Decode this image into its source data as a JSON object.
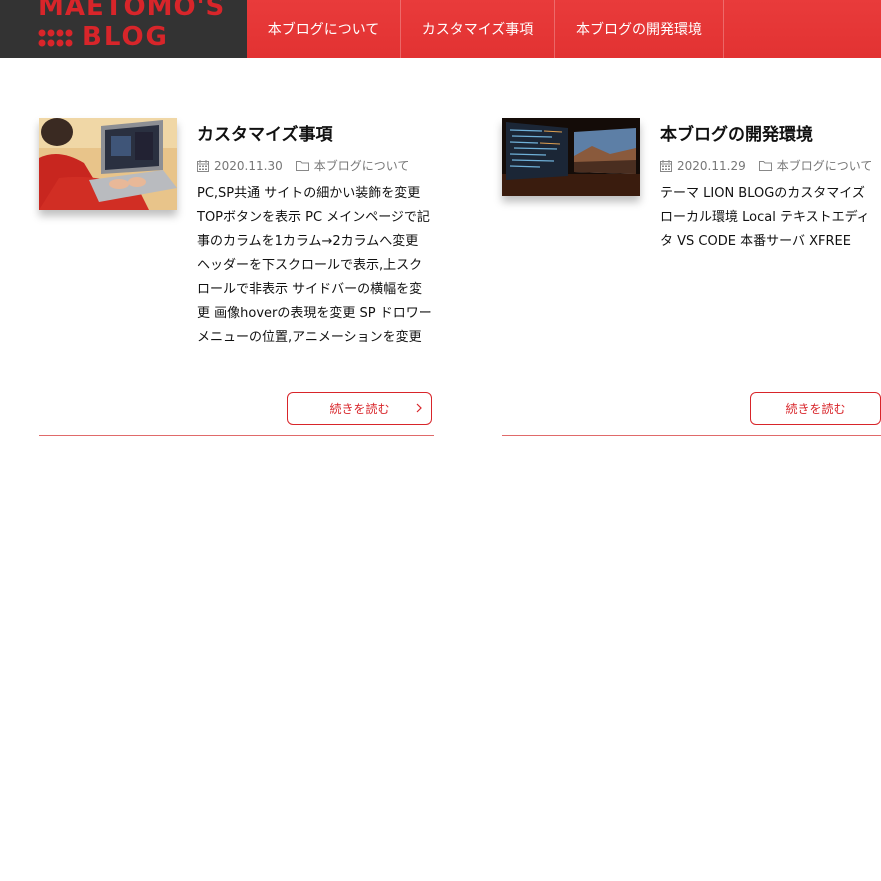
{
  "header": {
    "logo_line1": "MAETOMO'S",
    "logo_line2": "BLOG",
    "nav": [
      "本ブログについて",
      "カスタマイズ事項",
      "本ブログの開発環境"
    ]
  },
  "posts": [
    {
      "title": "カスタマイズ事項",
      "date": "2020.11.30",
      "category": "本ブログについて",
      "excerpt": "PC,SP共通 サイトの細かい装飾を変更 TOPボタンを表示 PC メインページで記事のカラムを1カラム→2カラムへ変更 ヘッダーを下スクロールで表示,上スクロールで非表示 サイドバーの横幅を変更 画像hoverの表現を変更 SP ドロワーメニューの位置,アニメーションを変更",
      "read_more": "続きを読む",
      "thumb_icon": "laptop-photo"
    },
    {
      "title": "本ブログの開発環境",
      "date": "2020.11.29",
      "category": "本ブログについて",
      "excerpt": "テーマ LION BLOGのカスタマイズ ローカル環境 Local テキストエディタ VS CODE 本番サーバ XFREE",
      "read_more": "続きを読む",
      "thumb_icon": "monitors-photo"
    }
  ],
  "colors": {
    "accent": "#d8252a",
    "header_dark": "#333333",
    "nav_red": "#e53535"
  }
}
